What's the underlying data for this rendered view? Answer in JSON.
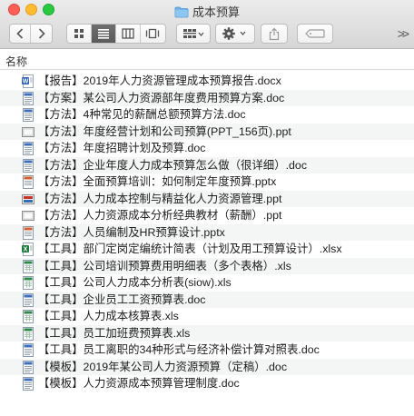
{
  "window": {
    "title": "成本预算"
  },
  "toolbar": {
    "icons": [
      "chevron-left-icon",
      "chevron-right-icon",
      "icon-view-icon",
      "list-view-icon",
      "column-view-icon",
      "cover-flow-icon",
      "group-icon",
      "gear-icon",
      "share-icon",
      "tag-icon",
      "more-icon"
    ],
    "more_label": ">>"
  },
  "list_header": {
    "name_column": "名称"
  },
  "files": [
    {
      "name": "【报告】2019年人力资源管理成本预算报告.docx",
      "type": "word-blue"
    },
    {
      "name": "【方案】某公司人力资源部年度费用预算方案.doc",
      "type": "doc"
    },
    {
      "name": "【方法】4种常见的薪酬总额预算方法.doc",
      "type": "doc"
    },
    {
      "name": "【方法】年度经营计划和公司预算(PPT_156页).ppt",
      "type": "ppt-gray"
    },
    {
      "name": "【方法】年度招聘计划及预算.doc",
      "type": "doc"
    },
    {
      "name": "【方法】企业年度人力成本预算怎么做（很详细）.doc",
      "type": "doc"
    },
    {
      "name": "【方法】全面预算培训：如何制定年度预算.pptx",
      "type": "pptx"
    },
    {
      "name": "【方法】人力成本控制与精益化人力资源管理.ppt",
      "type": "ppt-red"
    },
    {
      "name": "【方法】人力资源成本分析经典教材（薪酬）.ppt",
      "type": "ppt-gray"
    },
    {
      "name": "【方法】人员编制及HR预算设计.pptx",
      "type": "pptx"
    },
    {
      "name": "【工具】部门定岗定编统计简表（计划及用工预算设计）.xlsx",
      "type": "excel"
    },
    {
      "name": "【工具】公司培训预算费用明细表（多个表格）.xls",
      "type": "xls"
    },
    {
      "name": "【工具】公司人力成本分析表(siow).xls",
      "type": "xls"
    },
    {
      "name": "【工具】企业员工工资预算表.doc",
      "type": "doc"
    },
    {
      "name": "【工具】人力成本核算表.xls",
      "type": "xls"
    },
    {
      "name": "【工具】员工加班费预算表.xls",
      "type": "xls"
    },
    {
      "name": "【工具】员工离职的34种形式与经济补偿计算对照表.doc",
      "type": "doc"
    },
    {
      "name": "【模板】2019年某公司人力资源预算（定稿）.doc",
      "type": "doc"
    },
    {
      "name": "【模板】人力资源成本预算管理制度.doc",
      "type": "doc"
    }
  ]
}
